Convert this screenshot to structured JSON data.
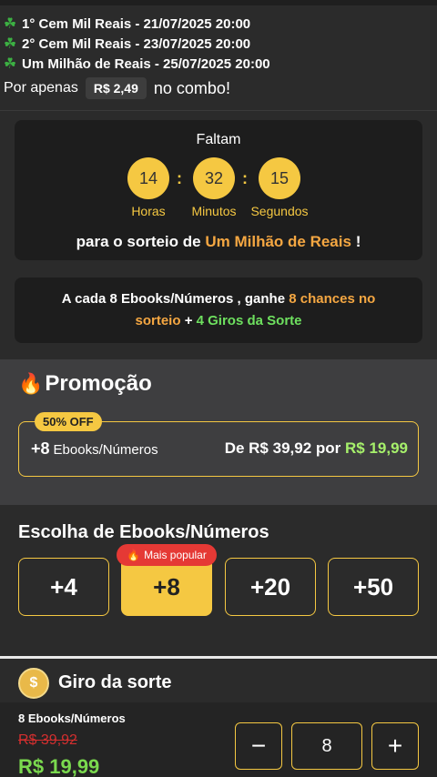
{
  "draws": [
    {
      "icon": "clover-icon",
      "text": "1° Cem Mil Reais - 21/07/2025 20:00"
    },
    {
      "icon": "clover-icon",
      "text": "2° Cem Mil Reais - 23/07/2025 20:00"
    },
    {
      "icon": "clover-icon",
      "text": "Um Milhão de Reais - 25/07/2025 20:00"
    }
  ],
  "combo": {
    "prefix": "Por apenas",
    "price": "R$ 2,49",
    "suffix": "no combo!"
  },
  "countdown": {
    "heading": "Faltam",
    "hours": "14",
    "minutes": "32",
    "seconds": "15",
    "hours_label": "Horas",
    "minutes_label": "Minutos",
    "seconds_label": "Segundos",
    "separator": ":",
    "sorteio_prefix": "para o sorteio de",
    "sorteio_highlight": "Um Milhão de Reais",
    "sorteio_suffix": "!"
  },
  "chances": {
    "part1": "A cada 8 Ebooks/Números , ganhe",
    "part2": "8 chances no sorteio",
    "part3": "+",
    "part4": "4 Giros da Sorte"
  },
  "promo": {
    "title": "Promoção",
    "badge": "50% OFF",
    "qty": "+8",
    "label": "Ebooks/Números",
    "from_text": "De R$ 39,92 por",
    "to_price": "R$ 19,99"
  },
  "choose": {
    "title": "Escolha de Ebooks/Números",
    "popular": "Mais popular",
    "options": [
      "+4",
      "+8",
      "+20",
      "+50"
    ],
    "selected": "+8"
  },
  "giro": {
    "label": "Giro da sorte",
    "icon_text": "$"
  },
  "bottom": {
    "name": "8 Ebooks/Números",
    "old_price": "R$ 39,92",
    "new_price": "R$ 19,99",
    "quantity": "8",
    "minus": "−",
    "plus": "+"
  },
  "colors": {
    "accent": "#f5c842",
    "green": "#7ad94e",
    "orange": "#f5a742",
    "red": "#e53935"
  }
}
